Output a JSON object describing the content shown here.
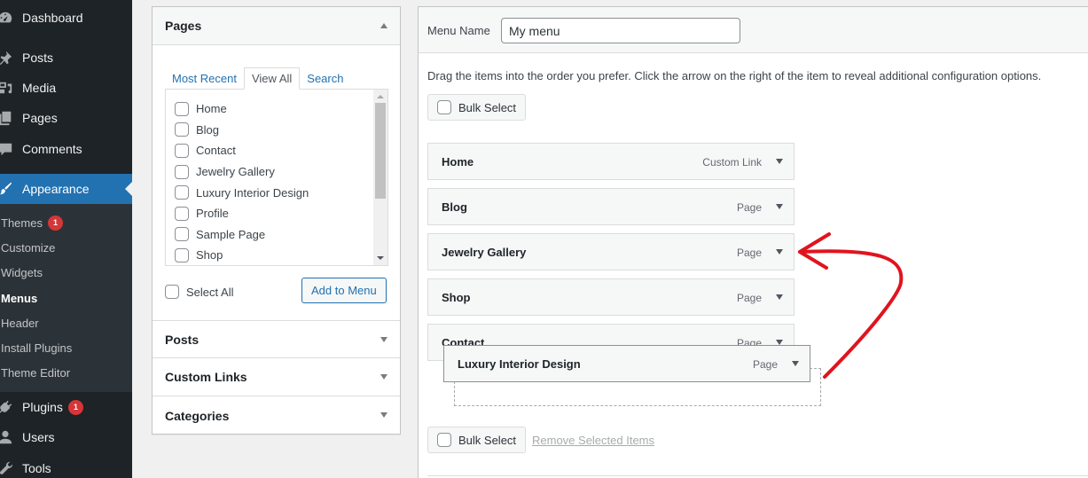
{
  "sidebar": {
    "menu": [
      {
        "label": "Dashboard",
        "icon": "dashboard-icon"
      },
      {
        "label": "Posts",
        "icon": "pin-icon"
      },
      {
        "label": "Media",
        "icon": "media-icon"
      },
      {
        "label": "Pages",
        "icon": "pages-icon"
      },
      {
        "label": "Comments",
        "icon": "comment-icon"
      },
      {
        "label": "Appearance",
        "icon": "paintbrush-icon",
        "active": true
      },
      {
        "label": "Plugins",
        "icon": "plugin-icon",
        "badge": "1"
      },
      {
        "label": "Users",
        "icon": "user-icon"
      },
      {
        "label": "Tools",
        "icon": "wrench-icon"
      }
    ],
    "submenu": [
      {
        "label": "Themes",
        "badge": "1"
      },
      {
        "label": "Customize"
      },
      {
        "label": "Widgets"
      },
      {
        "label": "Menus",
        "current": true
      },
      {
        "label": "Header"
      },
      {
        "label": "Install Plugins"
      },
      {
        "label": "Theme Editor"
      }
    ]
  },
  "add_items": {
    "pages": {
      "title": "Pages",
      "tabs": [
        "Most Recent",
        "View All",
        "Search"
      ],
      "active_tab": "View All",
      "items": [
        "Home",
        "Blog",
        "Contact",
        "Jewelry Gallery",
        "Luxury Interior Design",
        "Profile",
        "Sample Page",
        "Shop"
      ],
      "select_all_label": "Select All",
      "add_button_label": "Add to Menu"
    },
    "collapsed_sections": [
      "Posts",
      "Custom Links",
      "Categories"
    ]
  },
  "menu_editor": {
    "menu_name_label": "Menu Name",
    "menu_name_value": "My menu",
    "instructions": "Drag the items into the order you prefer. Click the arrow on the right of the item to reveal additional configuration options.",
    "bulk_select_label": "Bulk Select",
    "remove_selected_label": "Remove Selected Items",
    "items": [
      {
        "title": "Home",
        "type": "Custom Link"
      },
      {
        "title": "Blog",
        "type": "Page"
      },
      {
        "title": "Jewelry Gallery",
        "type": "Page"
      },
      {
        "title": "Shop",
        "type": "Page"
      },
      {
        "title": "Contact",
        "type": "Page"
      }
    ],
    "dragging_item": {
      "title": "Luxury Interior Design",
      "type": "Page"
    }
  },
  "annotation": {
    "type": "red-curved-arrow",
    "color": "#e0141e"
  }
}
